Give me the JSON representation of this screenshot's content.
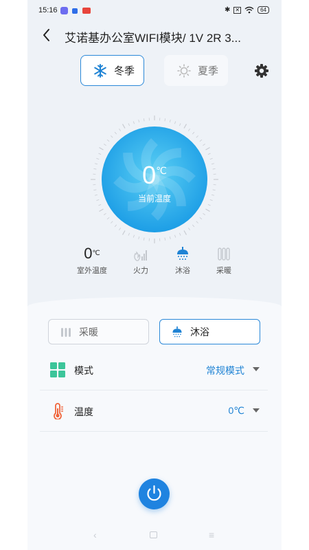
{
  "status_bar": {
    "time": "15:16",
    "battery": "64"
  },
  "header": {
    "title": "艾诺基办公室WIFI模块/ 1V 2R 3..."
  },
  "seasons": {
    "winter": "冬季",
    "summer": "夏季"
  },
  "dial": {
    "current_temp": "0",
    "unit": "℃",
    "label": "当前温度"
  },
  "stats": {
    "outdoor_value": "0",
    "outdoor_unit": "℃",
    "outdoor_label": "室外温度",
    "fire_label": "火力",
    "bath_label": "沐浴",
    "heating_label": "采暖"
  },
  "modes": {
    "heating": "采暖",
    "bath": "沐浴",
    "selected": "沐浴"
  },
  "settings": {
    "mode_label": "模式",
    "mode_value": "常规模式",
    "temp_label": "温度",
    "temp_value": "0℃"
  },
  "colors": {
    "accent": "#1f83d4",
    "dial_outer": "#2aa7e8",
    "dial_inner": "#4fc3f0",
    "thermo": "#f0643a",
    "mode_icon": "#3cc59a"
  }
}
